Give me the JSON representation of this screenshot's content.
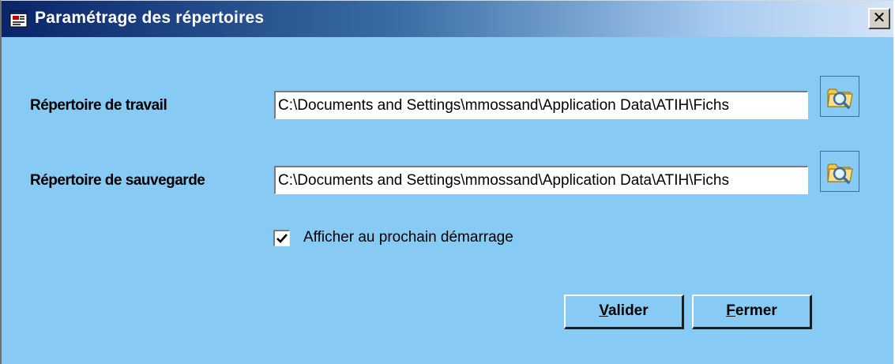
{
  "window": {
    "title": "Paramétrage des répertoires",
    "close_glyph": "✕"
  },
  "fields": {
    "work_dir_label": "Répertoire de travail",
    "work_dir_value": "C:\\Documents and Settings\\mmossand\\Application Data\\ATIH\\Fichs",
    "backup_dir_label": "Répertoire de sauvegarde",
    "backup_dir_value": "C:\\Documents and Settings\\mmossand\\Application Data\\ATIH\\Fichs"
  },
  "checkbox": {
    "label": "Afficher au prochain démarrage",
    "checked": true
  },
  "buttons": {
    "validate_first": "V",
    "validate_rest": "alider",
    "close_first": "F",
    "close_rest": "ermer"
  },
  "icons": {
    "app": "app-window-icon",
    "browse": "folder-search-icon",
    "check": "checkmark-icon"
  },
  "colors": {
    "dialog_bg": "#87cbf5",
    "title_start": "#0a246a",
    "title_end": "#d4e4f6"
  }
}
